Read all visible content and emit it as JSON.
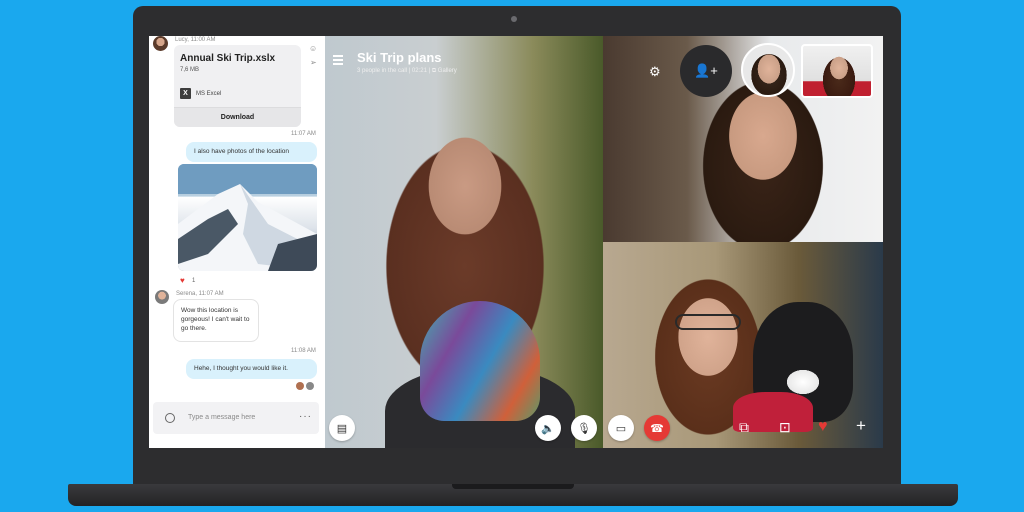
{
  "chat": {
    "sender1_meta": "Lucy, 11:00 AM",
    "file_name": "Annual Ski Trip.xslx",
    "file_size": "7,6 MB",
    "file_type": "MS Excel",
    "download_label": "Download",
    "time1": "11:07 AM",
    "msg_photos": "I also have photos of the location",
    "reaction_count": "1",
    "sender2_meta": "Serena, 11:07 AM",
    "msg_gorgeous": "Wow this location is gorgeous! I can't wait to go there.",
    "time2": "11:08 AM",
    "msg_liked": "Hehe, I thought you would like it.",
    "compose_placeholder": "Type a message here"
  },
  "call": {
    "title": "Ski Trip plans",
    "subtitle": "3 people in the call | 02:21 | ⧉ Gallery"
  },
  "icons": {
    "chat_toggle": "chat-bubble-icon",
    "speaker": "speaker-icon",
    "mic": "microphone-icon",
    "video": "video-camera-icon",
    "hangup": "phone-hangup-icon",
    "share": "screen-share-icon",
    "snapshot": "camera-snapshot-icon",
    "heart": "heart-icon",
    "plus": "plus-icon",
    "settings": "gear-icon",
    "add_person": "add-person-icon"
  },
  "colors": {
    "accent": "#1aa8ee",
    "bubble_out": "#d9f1fc",
    "hangup": "#e53935"
  }
}
